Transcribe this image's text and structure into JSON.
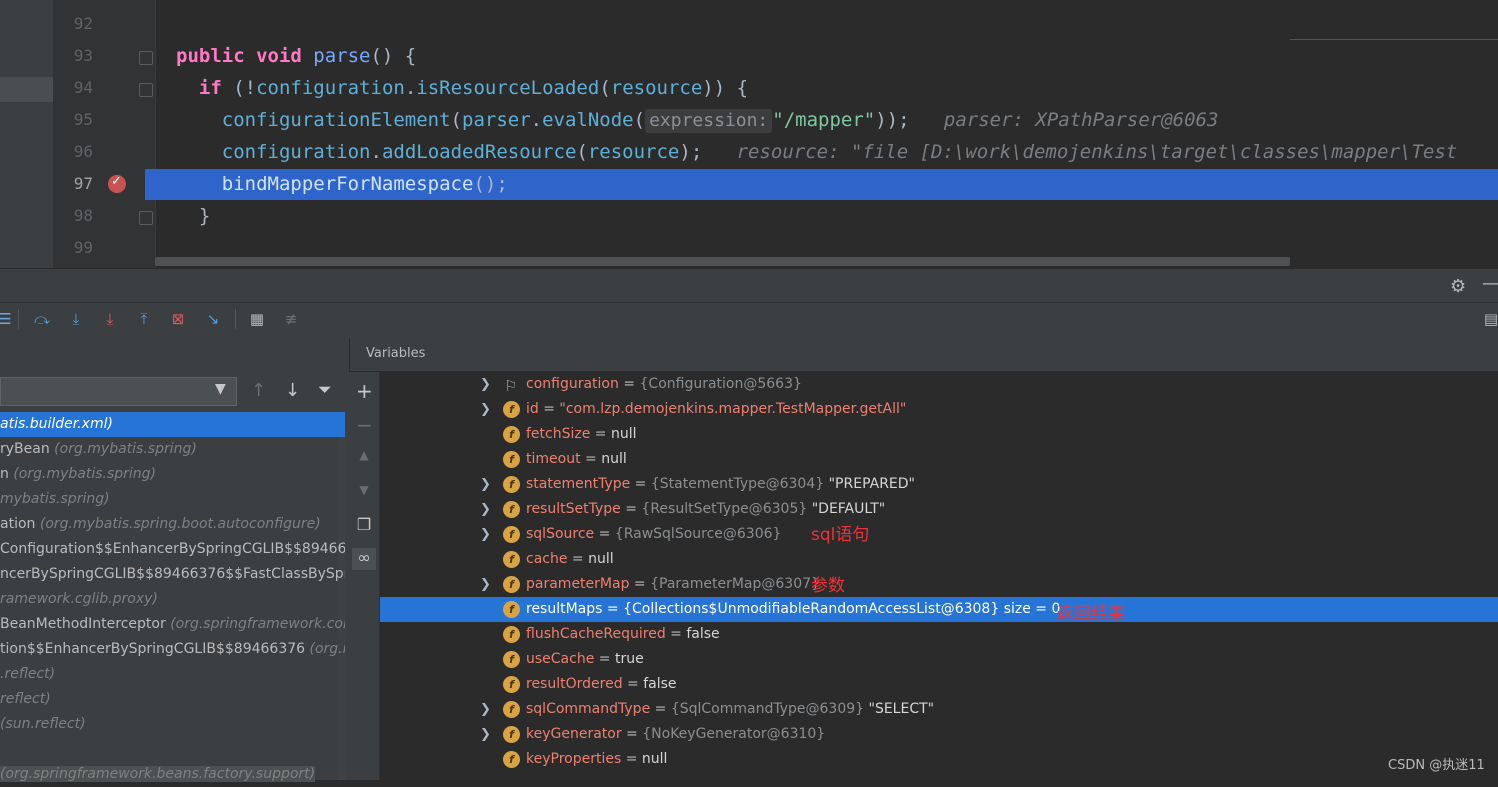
{
  "editor": {
    "line_numbers": [
      "92",
      "93",
      "94",
      "95",
      "96",
      "97",
      "98",
      "99"
    ],
    "lines": [
      {
        "indent": "",
        "parts": [
          {
            "t": "public ",
            "c": "kwp"
          },
          {
            "t": "void ",
            "c": "kwp"
          },
          {
            "t": "parse",
            "c": "fn"
          },
          {
            "t": "() {",
            "c": ""
          }
        ]
      },
      {
        "indent": "  ",
        "parts": [
          {
            "t": "if ",
            "c": "kwp"
          },
          {
            "t": "(!",
            "c": ""
          },
          {
            "t": "configuration",
            "c": "fld"
          },
          {
            "t": ".",
            "c": ""
          },
          {
            "t": "isResourceLoaded",
            "c": "fld"
          },
          {
            "t": "(",
            "c": ""
          },
          {
            "t": "resource",
            "c": "fld"
          },
          {
            "t": ")) {",
            "c": ""
          }
        ]
      },
      {
        "indent": "    ",
        "parts": [
          {
            "t": "configurationElement",
            "c": "fld"
          },
          {
            "t": "(",
            "c": ""
          },
          {
            "t": "parser",
            "c": "fld"
          },
          {
            "t": ".",
            "c": ""
          },
          {
            "t": "evalNode",
            "c": "fld"
          },
          {
            "t": "(",
            "c": ""
          },
          {
            "t": "expression:",
            "c": "hint"
          },
          {
            "t": "\"/mapper\"",
            "c": "str"
          },
          {
            "t": "));",
            "c": ""
          },
          {
            "t": "   parser: XPathParser@6063",
            "c": "dbgv"
          }
        ]
      },
      {
        "indent": "    ",
        "parts": [
          {
            "t": "configuration",
            "c": "fld"
          },
          {
            "t": ".",
            "c": ""
          },
          {
            "t": "addLoadedResource",
            "c": "fld"
          },
          {
            "t": "(",
            "c": ""
          },
          {
            "t": "resource",
            "c": "fld"
          },
          {
            "t": ");",
            "c": ""
          },
          {
            "t": "   resource: \"file [D:\\work\\demojenkins\\target\\classes\\mapper\\Test",
            "c": "dbgv"
          }
        ]
      },
      {
        "indent": "    ",
        "parts": [
          {
            "t": "bindMapperForNamespace",
            "c": "fld"
          },
          {
            "t": "();",
            "c": ""
          }
        ]
      },
      {
        "indent": "  ",
        "parts": [
          {
            "t": "}",
            "c": ""
          }
        ]
      }
    ]
  },
  "panels": {
    "variables_title": "Variables"
  },
  "frames": [
    {
      "method": "",
      "pkg": "atis.builder.xml)",
      "selected": true
    },
    {
      "method": "ryBean ",
      "pkg": "(org.mybatis.spring)"
    },
    {
      "method": "n ",
      "pkg": "(org.mybatis.spring)"
    },
    {
      "method": "",
      "pkg": "mybatis.spring)"
    },
    {
      "method": "ation ",
      "pkg": "(org.mybatis.spring.boot.autoconfigure)"
    },
    {
      "method": "Configuration$$EnhancerBySpringCGLIB$$89466376",
      "pkg": ""
    },
    {
      "method": "ncerBySpringCGLIB$$89466376$$FastClassBySpringC",
      "pkg": ""
    },
    {
      "method": "",
      "pkg": "ramework.cglib.proxy)"
    },
    {
      "method": "BeanMethodInterceptor ",
      "pkg": "(org.springframework.conte"
    },
    {
      "method": "tion$$EnhancerBySpringCGLIB$$89466376 ",
      "pkg": "(org.myb"
    },
    {
      "method": "",
      "pkg": ".reflect)"
    },
    {
      "method": "",
      "pkg": "reflect)"
    },
    {
      "method": "",
      "pkg": "(sun.reflect)"
    },
    {
      "method": "",
      "pkg": ""
    },
    {
      "method": "",
      "pkg": "(org.springframework.beans.factory.support)"
    }
  ],
  "variables": [
    {
      "name": "configuration",
      "type": "{Configuration@5663}",
      "value": "",
      "expand": true,
      "icon": "flag"
    },
    {
      "name": "id",
      "type": "",
      "value": "\"com.lzp.demojenkins.mapper.TestMapper.getAll\"",
      "string": true,
      "expand": true,
      "icon": "f"
    },
    {
      "name": "fetchSize",
      "type": "",
      "value": "null",
      "expand": false,
      "icon": "f"
    },
    {
      "name": "timeout",
      "type": "",
      "value": "null",
      "expand": false,
      "icon": "f"
    },
    {
      "name": "statementType",
      "type": "{StatementType@6304}",
      "value": "\"PREPARED\"",
      "expand": true,
      "icon": "f"
    },
    {
      "name": "resultSetType",
      "type": "{ResultSetType@6305}",
      "value": "\"DEFAULT\"",
      "expand": true,
      "icon": "f"
    },
    {
      "name": "sqlSource",
      "type": "{RawSqlSource@6306}",
      "value": "",
      "expand": true,
      "icon": "f"
    },
    {
      "name": "cache",
      "type": "",
      "value": "null",
      "expand": false,
      "icon": "f"
    },
    {
      "name": "parameterMap",
      "type": "{ParameterMap@6307}",
      "value": "",
      "expand": true,
      "icon": "f"
    },
    {
      "name": "resultMaps",
      "type": "{Collections$UnmodifiableRandomAccessList@6308}",
      "value": " size = 0",
      "expand": false,
      "icon": "f",
      "selected": true
    },
    {
      "name": "flushCacheRequired",
      "type": "",
      "value": "false",
      "expand": false,
      "icon": "f"
    },
    {
      "name": "useCache",
      "type": "",
      "value": "true",
      "expand": false,
      "icon": "f"
    },
    {
      "name": "resultOrdered",
      "type": "",
      "value": "false",
      "expand": false,
      "icon": "f"
    },
    {
      "name": "sqlCommandType",
      "type": "{SqlCommandType@6309}",
      "value": "\"SELECT\"",
      "expand": true,
      "icon": "f"
    },
    {
      "name": "keyGenerator",
      "type": "{NoKeyGenerator@6310}",
      "value": "",
      "expand": true,
      "icon": "f"
    },
    {
      "name": "keyProperties",
      "type": "",
      "value": "null",
      "expand": false,
      "icon": "f"
    }
  ],
  "annotations": {
    "sql": "sql语句",
    "params": "参数",
    "result": "返回结果"
  },
  "watermark": "CSDN @执迷11",
  "colors": {
    "selection": "#2675d6",
    "breakpoint": "#c75450",
    "annotation": "#e8343c"
  }
}
